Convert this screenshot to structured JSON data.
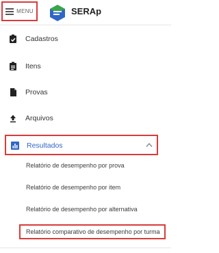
{
  "header": {
    "menu_label": "MENU",
    "brand": "SERAp",
    "logo_colors": {
      "blue": "#2f67c7",
      "green": "#3aa64a"
    }
  },
  "nav": {
    "items": [
      {
        "label": "Cadastros",
        "icon": "clipboard-check-icon"
      },
      {
        "label": "Itens",
        "icon": "clipboard-list-icon"
      },
      {
        "label": "Provas",
        "icon": "document-icon"
      },
      {
        "label": "Arquivos",
        "icon": "upload-icon"
      }
    ],
    "resultados": {
      "label": "Resultados",
      "icon": "bar-chart-icon",
      "expanded": true,
      "accent": "#2f67c7",
      "subitems": [
        "Relatório de desempenho por prova",
        "Relatório de desempenho por item",
        "Relatório de desempenho por alternativa",
        "Relatório comparativo de desempenho por turma"
      ]
    }
  },
  "highlight_color": "#d93a3a"
}
